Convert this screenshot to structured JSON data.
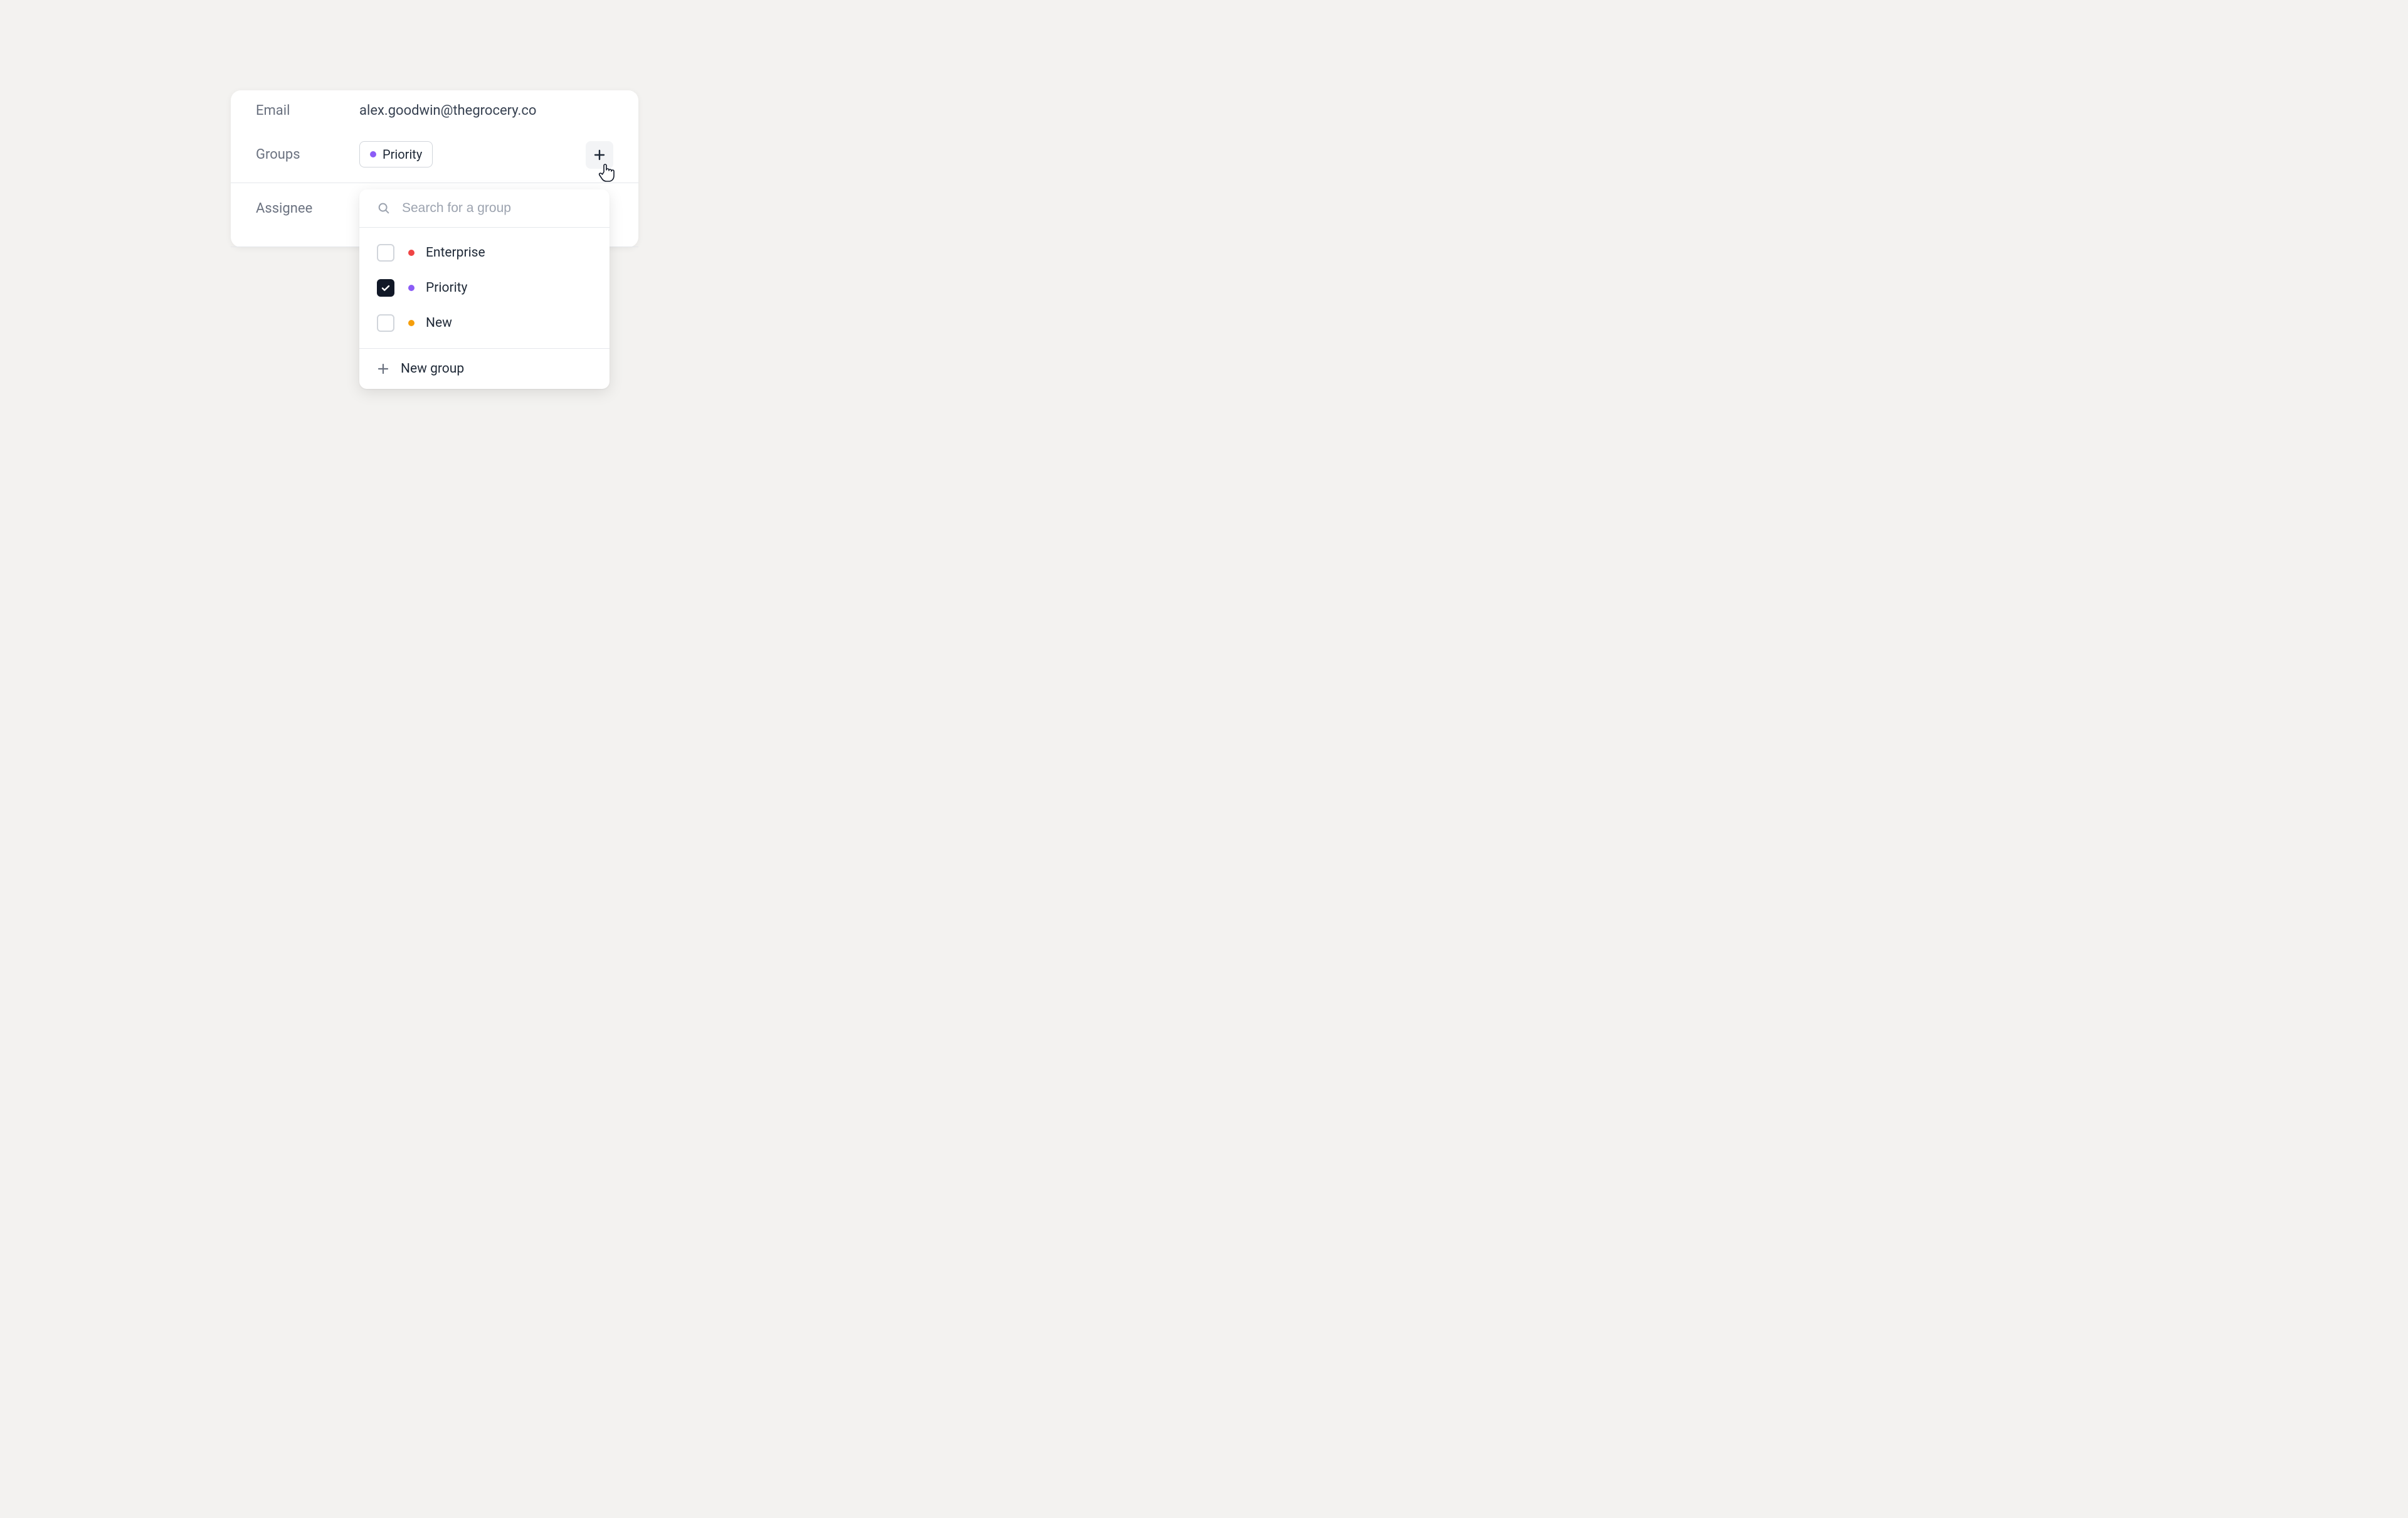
{
  "fields": {
    "email": {
      "label": "Email",
      "value": "alex.goodwin@thegrocery.co"
    },
    "groups": {
      "label": "Groups"
    },
    "assignee": {
      "label": "Assignee"
    }
  },
  "tag": {
    "label": "Priority",
    "color": "#8b5cf6"
  },
  "dropdown": {
    "search_placeholder": "Search for a group",
    "options": [
      {
        "label": "Enterprise",
        "color": "#ef4444",
        "checked": false
      },
      {
        "label": "Priority",
        "color": "#8b5cf6",
        "checked": true
      },
      {
        "label": "New",
        "color": "#f59e0b",
        "checked": false
      }
    ],
    "new_group_label": "New group"
  },
  "icons": {
    "plus": "plus-icon",
    "search": "search-icon",
    "check": "check-icon",
    "cursor": "pointer-cursor-icon"
  }
}
